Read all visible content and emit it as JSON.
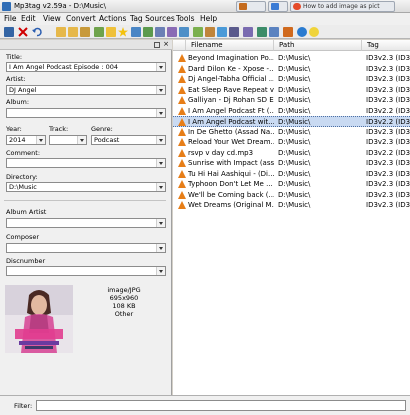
{
  "window": {
    "title": "Mp3tag v2.59a  -  D:\\Music\\",
    "taskbar_item": "How to add image as pict"
  },
  "menu": [
    "File",
    "Edit",
    "View",
    "Convert",
    "Actions",
    "Tag Sources",
    "Tools",
    "Help"
  ],
  "tag_panel": {
    "title_label": "Title:",
    "title_value": "I Am Angel Podcast Episode : 004",
    "artist_label": "Artist:",
    "artist_value": "DJ Angel",
    "album_label": "Album:",
    "album_value": "",
    "year_label": "Year:",
    "year_value": "2014",
    "track_label": "Track:",
    "track_value": "",
    "genre_label": "Genre:",
    "genre_value": "Podcast",
    "comment_label": "Comment:",
    "comment_value": "",
    "directory_label": "Directory:",
    "directory_value": "D:\\Music",
    "album_artist_label": "Album Artist",
    "album_artist_value": "",
    "composer_label": "Composer",
    "composer_value": "",
    "discnumber_label": "Discnumber",
    "discnumber_value": ""
  },
  "cover_info": {
    "format": "image/JPG",
    "dimensions": "695x960",
    "size": "108 KB",
    "type": "Other"
  },
  "file_list": {
    "columns": [
      "Filename",
      "Path",
      "Tag"
    ],
    "rows": [
      {
        "filename": "Beyond Imagination Po...",
        "path": "D:\\Music\\",
        "tag": "ID3v2.3 (ID3v2..."
      },
      {
        "filename": "Dard Dilon Ke - Xpose -...",
        "path": "D:\\Music\\",
        "tag": "ID3v2.3 (ID3v2..."
      },
      {
        "filename": "Dj Angel-Tabha Official ...",
        "path": "D:\\Music\\",
        "tag": "ID3v2.3 (ID3v2..."
      },
      {
        "filename": "Eat Sleep Rave Repeat v...",
        "path": "D:\\Music\\",
        "tag": "ID3v2.3 (ID3v2..."
      },
      {
        "filename": "Galliyan - Dj Rohan SD E...",
        "path": "D:\\Music\\",
        "tag": "ID3v2.3 (ID3v2..."
      },
      {
        "filename": "I Am Angel Podcast Ft (...",
        "path": "D:\\Music\\",
        "tag": "ID3v2.2 (ID3v2..."
      },
      {
        "filename": "I Am Angel Podcast wit...",
        "path": "D:\\Music\\",
        "tag": "ID3v2.2 (ID3v2...",
        "selected": true
      },
      {
        "filename": "In De Ghetto (Assad Na...",
        "path": "D:\\Music\\",
        "tag": "ID3v2.3 (ID3v1..."
      },
      {
        "filename": "Reload Your Wet Dream...",
        "path": "D:\\Music\\",
        "tag": "ID3v2.3 (ID3v1..."
      },
      {
        "filename": "rsvp v day cd.mp3",
        "path": "D:\\Music\\",
        "tag": "ID3v2.2 (ID3v2..."
      },
      {
        "filename": "Sunrise with Impact (ass...",
        "path": "D:\\Music\\",
        "tag": "ID3v2.3 (ID3v2..."
      },
      {
        "filename": "Tu Hi Hai Aashiqui - (Di...",
        "path": "D:\\Music\\",
        "tag": "ID3v2.3 (ID3v2..."
      },
      {
        "filename": "Typhoon Don't Let Me ...",
        "path": "D:\\Music\\",
        "tag": "ID3v2.3 (ID3v1..."
      },
      {
        "filename": "We'll be Coming back (...",
        "path": "D:\\Music\\",
        "tag": "ID3v2.3 (ID3v2..."
      },
      {
        "filename": "Wet Dreams (Original M...",
        "path": "D:\\Music\\",
        "tag": "ID3v2.3 (ID3v2..."
      }
    ]
  },
  "filter": {
    "label": "Filter:",
    "value": ""
  }
}
